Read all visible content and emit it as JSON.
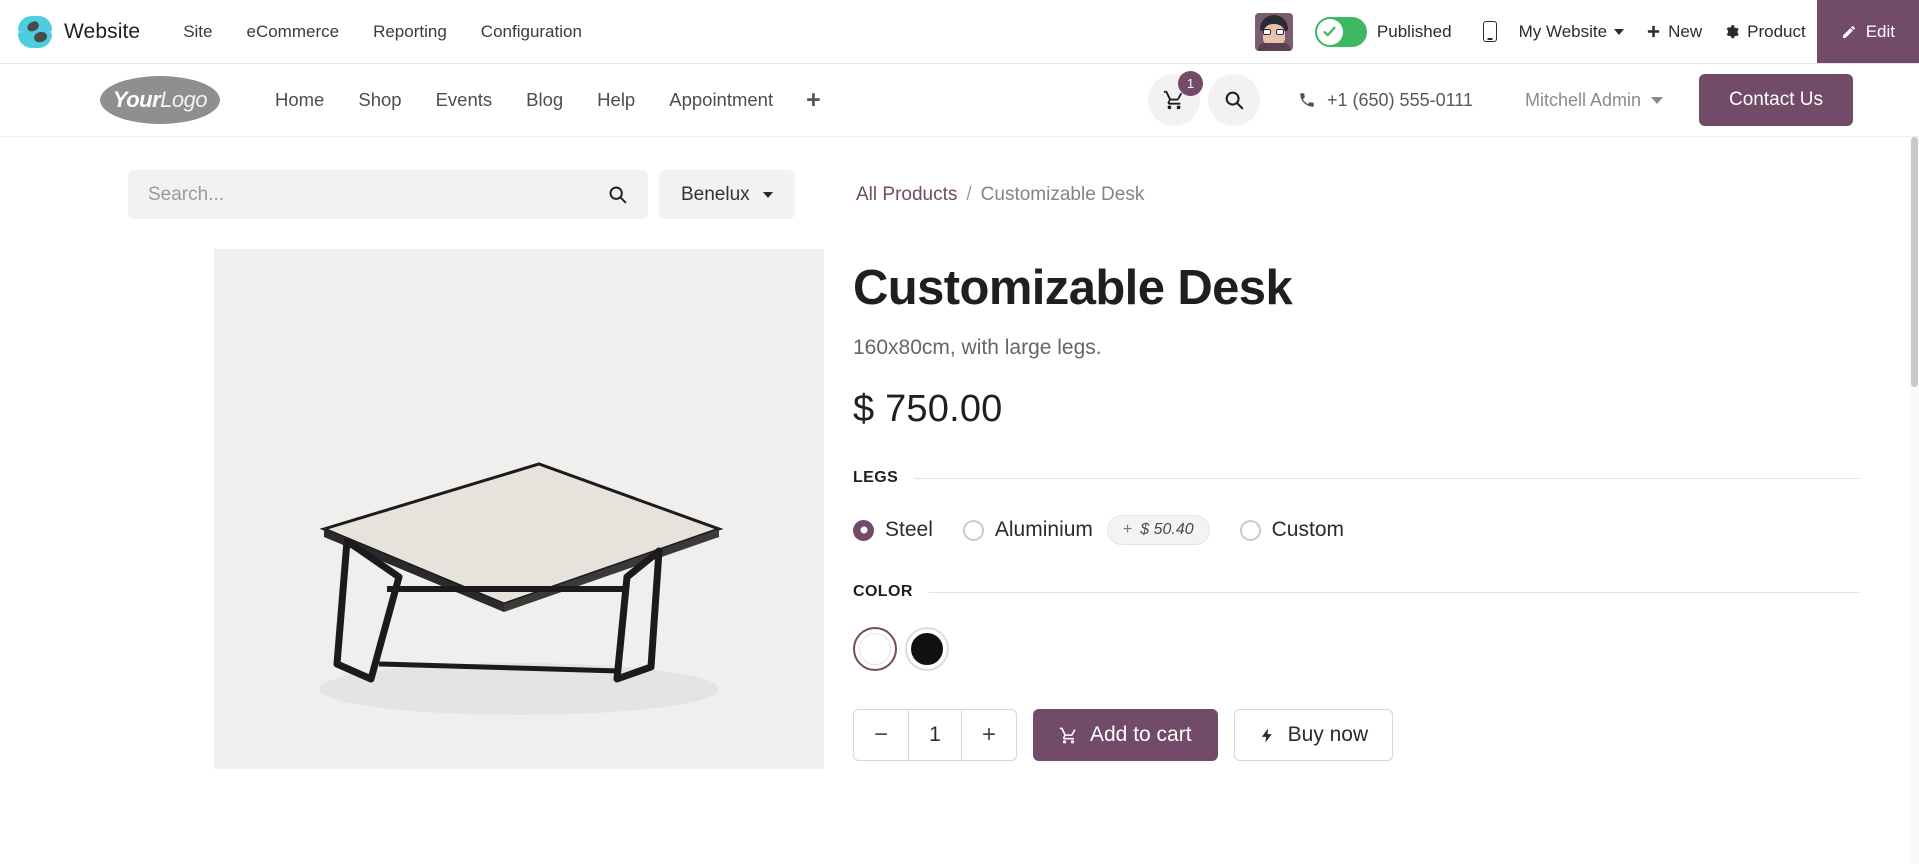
{
  "backend": {
    "app_name": "Website",
    "menus": [
      "Site",
      "eCommerce",
      "Reporting",
      "Configuration"
    ],
    "publish_label": "Published",
    "website_selector": "My Website",
    "new_label": "New",
    "record_label": "Product",
    "edit_label": "Edit",
    "accent_color": "#714b67",
    "published_color": "#3cb85f"
  },
  "site_header": {
    "logo_bold": "Your",
    "logo_light": "Logo",
    "nav": [
      "Home",
      "Shop",
      "Events",
      "Blog",
      "Help",
      "Appointment"
    ],
    "add_menu_glyph": "+",
    "cart_count": "1",
    "phone": "+1 (650) 555-0111",
    "user_name": "Mitchell Admin",
    "contact_label": "Contact Us"
  },
  "toolbar": {
    "search_placeholder": "Search...",
    "search_value": "",
    "pricelist": "Benelux"
  },
  "breadcrumb": {
    "parent": "All Products",
    "separator": "/",
    "current": "Customizable Desk"
  },
  "product": {
    "name": "Customizable Desk",
    "subtitle": "160x80cm, with large legs.",
    "price": "$ 750.00",
    "quantity": "1",
    "add_to_cart_label": "Add to cart",
    "buy_now_label": "Buy now",
    "qty_minus": "−",
    "qty_plus": "+",
    "attributes": [
      {
        "name": "LEGS",
        "type": "radio",
        "options": [
          {
            "label": "Steel",
            "selected": true,
            "extra_price": ""
          },
          {
            "label": "Aluminium",
            "selected": false,
            "extra_price": "$ 50.40",
            "extra_sign": "+"
          },
          {
            "label": "Custom",
            "selected": false,
            "extra_price": ""
          }
        ]
      },
      {
        "name": "COLOR",
        "type": "swatch",
        "options": [
          {
            "label": "White",
            "hex": "#ffffff",
            "selected": true
          },
          {
            "label": "Black",
            "hex": "#111111",
            "selected": false
          }
        ]
      }
    ]
  }
}
